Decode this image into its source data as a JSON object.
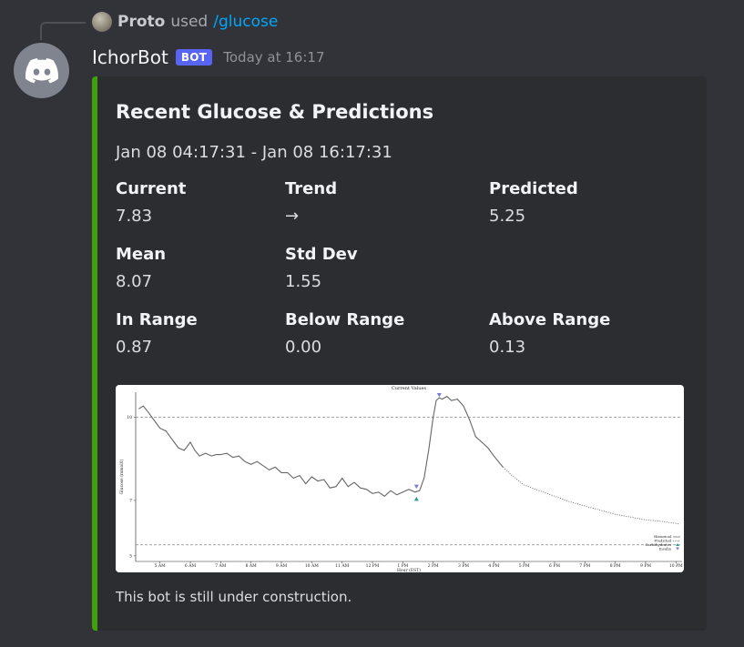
{
  "reply": {
    "user": "Proto",
    "used": "used",
    "command": "/glucose"
  },
  "message": {
    "username": "IchorBot",
    "bot_tag": "BOT",
    "timestamp": "Today at 16:17"
  },
  "embed": {
    "accent_color": "#3fa00c",
    "title": "Recent Glucose & Predictions",
    "description": "Jan 08 04:17:31 - Jan 08 16:17:31",
    "fields": [
      {
        "name": "Current",
        "value": "7.83"
      },
      {
        "name": "Trend",
        "value": "→"
      },
      {
        "name": "Predicted",
        "value": "5.25"
      },
      {
        "name": "Mean",
        "value": "8.07"
      },
      {
        "name": "Std Dev",
        "value": "1.55"
      },
      {
        "name": "In Range",
        "value": "0.87"
      },
      {
        "name": "Below Range",
        "value": "0.00"
      },
      {
        "name": "Above Range",
        "value": "0.13"
      }
    ],
    "footer": "This bot is still under construction."
  },
  "chart_data": {
    "type": "line",
    "title": "Current Values",
    "xlabel": "Hour (EST)",
    "ylabel": "Glucose (mmol/l)",
    "x_ticks": [
      "5 AM",
      "6 AM",
      "7 AM",
      "8 AM",
      "9 AM",
      "10 AM",
      "11 AM",
      "12 PM",
      "1 PM",
      "2 PM",
      "3 PM",
      "4 PM",
      "5 PM",
      "6 PM",
      "7 PM",
      "8 PM",
      "9 PM",
      "10 PM"
    ],
    "y_ticks": [
      "5",
      "7",
      "10"
    ],
    "xlim": [
      4.2,
      22.2
    ],
    "ylim": [
      4.8,
      10.9
    ],
    "thresholds": [
      10,
      5.4
    ],
    "grid": false,
    "legend": [
      "Historical",
      "Predicted",
      "Carbohydrates",
      "Insulin"
    ],
    "legend_placement": "bottom-right",
    "series": [
      {
        "name": "Historical",
        "x": [
          4.3,
          4.45,
          4.6,
          4.8,
          5.0,
          5.2,
          5.4,
          5.6,
          5.8,
          6.0,
          6.15,
          6.3,
          6.5,
          6.7,
          6.85,
          7.0,
          7.2,
          7.4,
          7.6,
          7.8,
          8.0,
          8.2,
          8.4,
          8.6,
          8.8,
          9.0,
          9.2,
          9.4,
          9.6,
          9.8,
          10.0,
          10.2,
          10.4,
          10.6,
          10.8,
          11.0,
          11.2,
          11.4,
          11.6,
          11.8,
          12.0,
          12.2,
          12.4,
          12.6,
          12.8,
          13.0,
          13.2,
          13.4,
          13.55,
          13.7,
          13.85,
          14.0,
          14.1,
          14.2,
          14.3,
          14.45,
          14.6,
          14.8,
          15.0,
          15.2,
          15.4,
          15.6,
          15.8,
          16.0,
          16.15,
          16.3
        ],
        "y": [
          10.3,
          10.4,
          10.2,
          9.9,
          9.6,
          9.5,
          9.2,
          8.9,
          8.8,
          9.1,
          8.8,
          8.6,
          8.7,
          8.6,
          8.65,
          8.65,
          8.7,
          8.55,
          8.6,
          8.4,
          8.3,
          8.4,
          8.25,
          8.1,
          8.2,
          8.0,
          8.0,
          7.8,
          7.9,
          7.6,
          7.85,
          7.7,
          7.75,
          7.45,
          7.5,
          7.8,
          7.5,
          7.65,
          7.45,
          7.4,
          7.25,
          7.3,
          7.15,
          7.35,
          7.2,
          7.3,
          7.4,
          7.3,
          7.35,
          7.8,
          8.8,
          10.0,
          10.6,
          10.7,
          10.65,
          10.75,
          10.6,
          10.65,
          10.4,
          9.9,
          9.3,
          9.1,
          8.9,
          8.6,
          8.4,
          8.2
        ]
      },
      {
        "name": "Predicted",
        "x": [
          16.3,
          16.6,
          17.0,
          17.5,
          18.0,
          18.5,
          19.0,
          19.5,
          20.0,
          20.5,
          21.0,
          21.5,
          22.1
        ],
        "y": [
          8.2,
          7.9,
          7.55,
          7.35,
          7.15,
          6.95,
          6.8,
          6.65,
          6.5,
          6.4,
          6.3,
          6.25,
          6.15
        ]
      },
      {
        "name": "Carbohydrates",
        "x": [
          13.45
        ],
        "y": [
          7.05
        ]
      },
      {
        "name": "Insulin",
        "x": [
          13.45,
          14.2
        ],
        "y": [
          7.5,
          10.8
        ]
      }
    ]
  }
}
